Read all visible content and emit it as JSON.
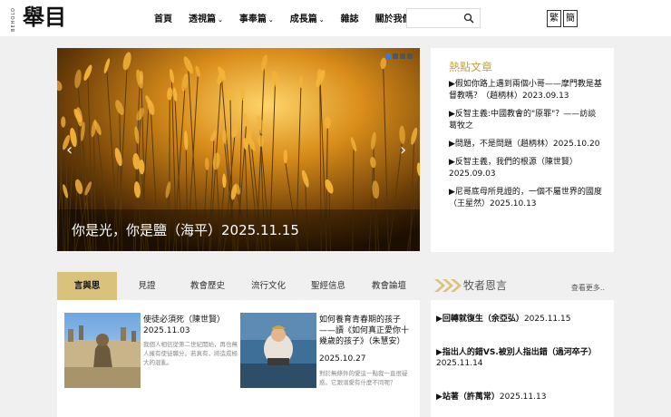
{
  "header": {
    "logo_latin": "BEHOLD",
    "logo_cjk": "舉目",
    "nav": [
      {
        "label": "首頁",
        "has_dropdown": false
      },
      {
        "label": "透視篇",
        "has_dropdown": true
      },
      {
        "label": "事奉篇",
        "has_dropdown": true
      },
      {
        "label": "成長篇",
        "has_dropdown": true
      },
      {
        "label": "雜誌",
        "has_dropdown": false
      },
      {
        "label": "關於我們",
        "has_dropdown": false
      }
    ],
    "search": {
      "value": "",
      "placeholder": "",
      "icon": "search-icon"
    },
    "lang": {
      "traditional": "繁",
      "simplified": "簡"
    }
  },
  "hero": {
    "caption": "你是光，你是鹽（海平）2025.11.15",
    "prev_icon": "chevron-left-icon",
    "next_icon": "chevron-right-icon",
    "active_dot": 0,
    "dot_count": 4
  },
  "hot": {
    "title": "熱點文章",
    "items": [
      "▶假如你路上遇到兩個小哥——摩門教是基督教嗎？（趙柄林）2023.09.13",
      "▶反智主義:中國教會的\"原罪\"？——訪談葛牧之",
      "▶問題，不是問題（趙柄林）2025.10.20",
      "▶反智主義，我們的根源（陳世賢）2025.09.03",
      "▶尼哥底母所見證的，一個不屬世界的國度（王星然）2025.10.13"
    ]
  },
  "tabs": [
    {
      "label": "言與思",
      "active": true
    },
    {
      "label": "見證",
      "active": false
    },
    {
      "label": "教會歷史",
      "active": false
    },
    {
      "label": "流行文化",
      "active": false
    },
    {
      "label": "聖經信息",
      "active": false
    },
    {
      "label": "教會論壇",
      "active": false
    }
  ],
  "articles": [
    {
      "title": "使徒必須死（陳世賢）",
      "date": "2025.11.03",
      "excerpt": "我個人相信從第二世紀開始，再也無人擁有使徒職分。若真有，將造成極大的混亂。"
    },
    {
      "title": "如何養育青春期的孩子——讀《如何真正愛你十幾歲的孩子》（朱慧安）",
      "date": "2025.10.27",
      "excerpt": "對於無條件的愛這一點我一直很疑惑。它跟溺愛有什麼不同呢？"
    }
  ],
  "pastor": {
    "title": "牧者恩言",
    "more": "查看更多..",
    "items": [
      {
        "title": "▶回轉就復生（余亞弘）",
        "date": "2025.11.15"
      },
      {
        "title": "▶指出人的錯VS.被別人指出錯（過河卒子）",
        "date": "2025.11.14"
      },
      {
        "title": "▶站著（許萬常）",
        "date": "2025.11.13"
      }
    ]
  },
  "colors": {
    "accent_gold": "#c2a24a",
    "tab_active": "#d9c27c",
    "slider_dot_active": "#3a7bd5"
  }
}
